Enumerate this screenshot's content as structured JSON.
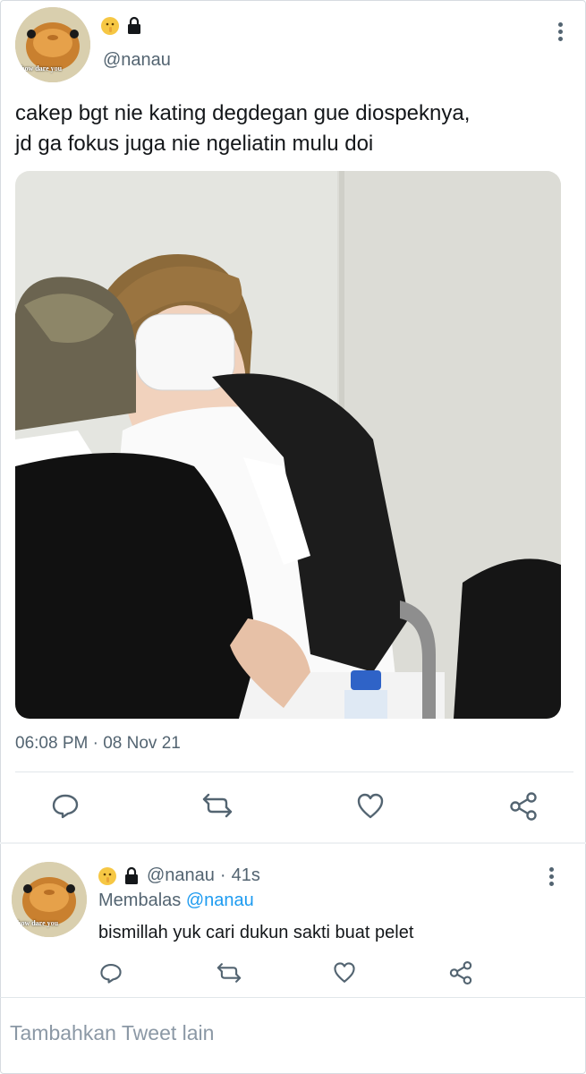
{
  "main_tweet": {
    "handle": "@nanau",
    "avatar_caption": "how dare you",
    "text_line1": "cakep bgt nie kating degdegan gue diospeknya,",
    "text_line2": "jd ga fokus juga nie ngeliatin mulu doi",
    "timestamp": "06:08 PM · 08 Nov 21",
    "actions": [
      "reply-icon",
      "retweet-icon",
      "like-icon",
      "share-icon"
    ]
  },
  "reply_tweet": {
    "handle": "@nanau",
    "separator": "·",
    "time": "41s",
    "replying_label": "Membalas",
    "replying_to": "@nanau",
    "avatar_caption": "how dare you",
    "text": "bismillah yuk cari dukun sakti buat pelet"
  },
  "composer": {
    "placeholder": "Tambahkan Tweet lain"
  },
  "colors": {
    "accent": "#1d9bf0",
    "muted": "#536471",
    "text": "#14171a"
  }
}
